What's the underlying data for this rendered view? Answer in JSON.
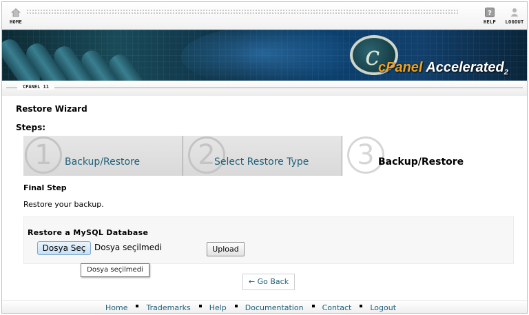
{
  "topnav": {
    "home_label": "HOME",
    "help_label": "HELP",
    "logout_label": "LOGOUT"
  },
  "banner": {
    "logo_c": "c",
    "logo_cpanel": "cPanel",
    "logo_accelerated": "Accelerated",
    "logo_version": "2"
  },
  "breadcrumb": "CPANEL 11",
  "page": {
    "title": "Restore Wizard",
    "steps_label": "Steps:"
  },
  "steps": [
    {
      "number": "1",
      "label": "Backup/Restore",
      "state": "done"
    },
    {
      "number": "2",
      "label": "Select Restore Type",
      "state": "done"
    },
    {
      "number": "3",
      "label": "Backup/Restore",
      "state": "current"
    }
  ],
  "final_step": {
    "heading": "Final Step",
    "description": "Restore your backup."
  },
  "restore_panel": {
    "title": "Restore a MySQL Database",
    "file_button": "Dosya Seç",
    "file_status": "Dosya seçilmedi",
    "upload_button": "Upload",
    "tooltip": "Dosya seçilmedi"
  },
  "go_back": "← Go Back",
  "footer": {
    "links": [
      "Home",
      "Trademarks",
      "Help",
      "Documentation",
      "Contact",
      "Logout"
    ]
  },
  "colors": {
    "link": "#1d5f78",
    "accent_orange": "#f0a21d"
  }
}
